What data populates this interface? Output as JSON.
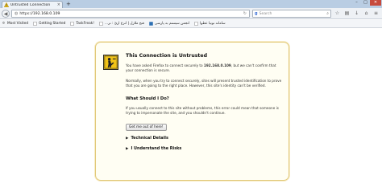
{
  "tab": {
    "title": "Untrusted Connection",
    "close": "×",
    "new_tab": "+"
  },
  "window_controls": {
    "minimize": "–",
    "maximize": "□",
    "close": "✕"
  },
  "navbar": {
    "url_scheme": "https://",
    "url_host": "192.168.0.109",
    "search_engine_glyph": "g",
    "search_placeholder": "Search"
  },
  "bookmarks": [
    {
      "label": "Most Visited",
      "icon": "gear-icon"
    },
    {
      "label": "Getting Started",
      "icon": "page-icon"
    },
    {
      "label": "TaskFreak!",
      "icon": "page-icon"
    },
    {
      "label": "...فتح ملازل | انزع ازئ : نر",
      "icon": "page-icon"
    },
    {
      "label": "انجمن سیستم به پارسی",
      "icon": "page-icon"
    },
    {
      "label": "سامانه توتیا عطوا",
      "icon": "page-icon"
    }
  ],
  "error": {
    "title": "This Connection is Untrusted",
    "p1_prefix": "You have asked Firefox to connect securely to ",
    "p1_host": "192.168.0.109",
    "p1_suffix": ", but we can't confirm that your connection is secure.",
    "p2": "Normally, when you try to connect securely, sites will present trusted identification to prove that you are going to the right place. However, this site's identity can't be verified.",
    "what_heading": "What Should I Do?",
    "p3": "If you usually connect to this site without problems, this error could mean that someone is trying to impersonate the site, and you shouldn't continue.",
    "get_out_button": "Get me out of here!",
    "technical_details": "Technical Details",
    "understand_risks": "I Understand the Risks",
    "expander_glyph": "▶"
  },
  "colors": {
    "box_background": "#fffef3",
    "box_border": "#e2c97a",
    "icon_yellow": "#f2c418"
  }
}
